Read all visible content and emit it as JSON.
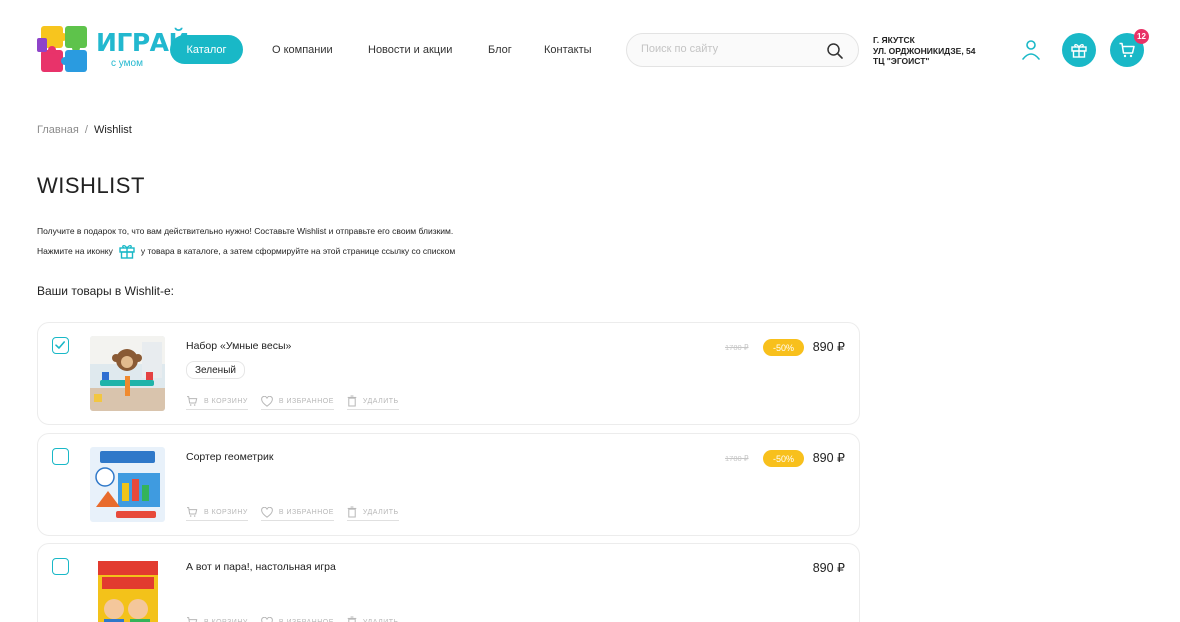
{
  "header": {
    "logo_text": "ИГРАЙ",
    "logo_sub": "с умом",
    "catalog_label": "Каталог",
    "nav": [
      "О компании",
      "Новости и акции",
      "Блог",
      "Контакты"
    ],
    "search_placeholder": "Поиск по сайту",
    "address": [
      "г. Якутск",
      "ул. Орджоникидзе, 54",
      "ТЦ \"Эгоист\""
    ],
    "cart_count": "12"
  },
  "breadcrumb": {
    "home": "Главная",
    "separator": "/",
    "current": "Wishlist"
  },
  "page": {
    "title": "WISHLIST",
    "intro_line1": "Получите в подарок то, что вам действительно нужно! Составьте Wishlist и отправьте его своим близким.",
    "intro_line2_before": "Нажмите на иконку",
    "intro_line2_after": "у товара в каталоге, а затем сформируйте на этой странице ссылку со списком",
    "section_label": "Ваши товары в Wishlit-е:"
  },
  "actions": {
    "to_cart": "в корзину",
    "to_favorites": "в избранное",
    "delete": "удалить"
  },
  "products": [
    {
      "name": "Набор «Умные весы»",
      "variant": "Зеленый",
      "old_price": "1780 ₽",
      "discount": "-50%",
      "price": "890 ₽",
      "checked": true
    },
    {
      "name": "Сортер геометрик",
      "variant": "",
      "old_price": "1780 ₽",
      "discount": "-50%",
      "price": "890 ₽",
      "checked": false
    },
    {
      "name": "А вот и пара!, настольная игра",
      "variant": "",
      "old_price": "",
      "discount": "",
      "price": "890 ₽",
      "checked": false
    }
  ],
  "colors": {
    "accent": "#19b8c7",
    "discount": "#f8c01c",
    "badge": "#e83367"
  }
}
